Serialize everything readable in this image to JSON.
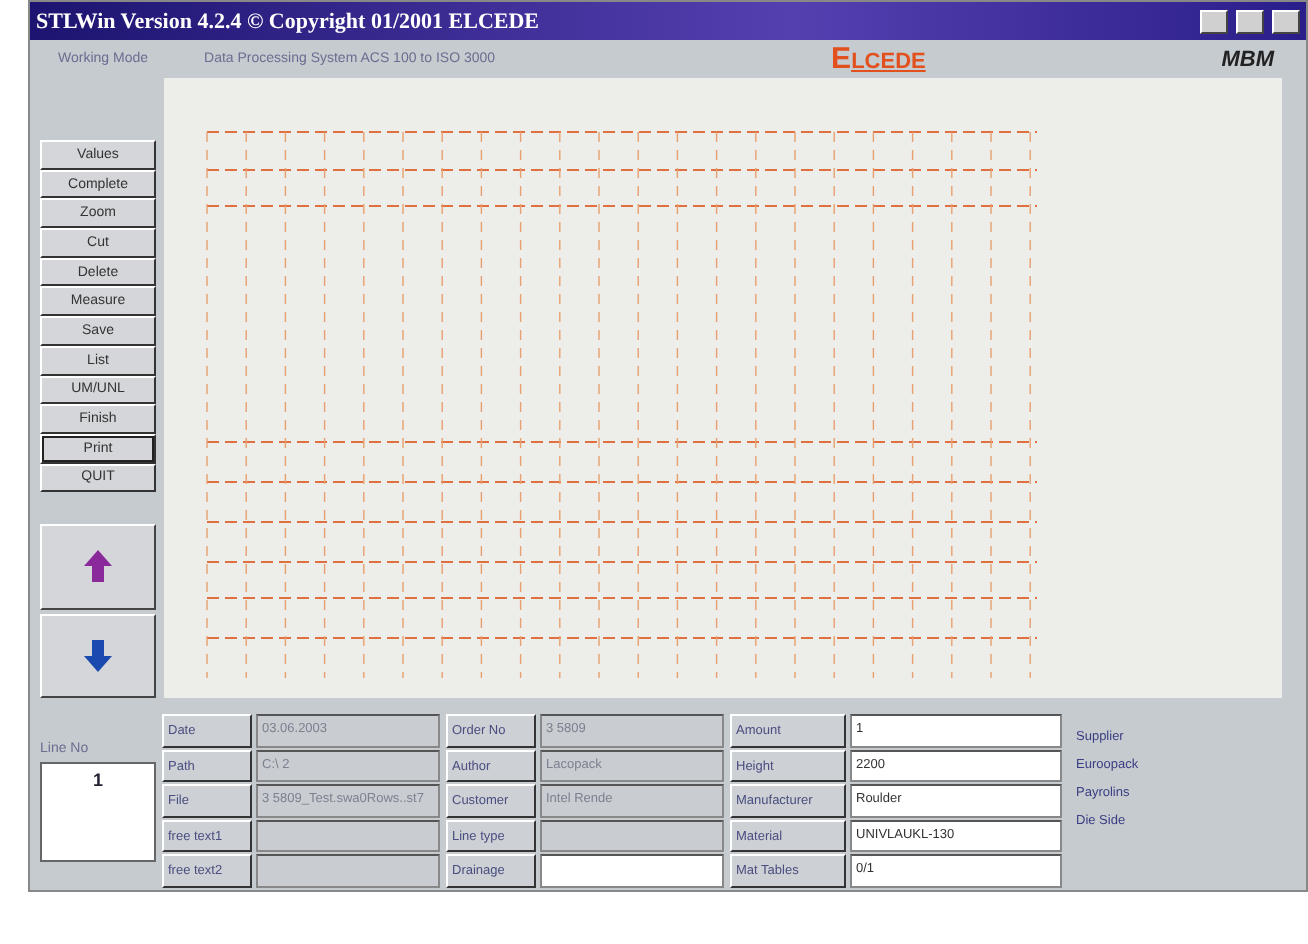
{
  "window": {
    "title": "STLWin Version 4.2.4 © Copyright 01/2001 ELCEDE"
  },
  "header": {
    "mode": "Working Mode",
    "system": "Data Processing System ACS 100 to ISO 3000",
    "logo_first": "E",
    "logo_rest": "LCEDE",
    "brand": "MBM"
  },
  "commands": [
    {
      "label": "Values",
      "selected": false
    },
    {
      "label": "Complete",
      "selected": false
    },
    {
      "label": "Zoom",
      "selected": false
    },
    {
      "label": "Cut",
      "selected": false
    },
    {
      "label": "Delete",
      "selected": false
    },
    {
      "label": "Measure",
      "selected": false
    },
    {
      "label": "Save",
      "selected": false
    },
    {
      "label": "List",
      "selected": false
    },
    {
      "label": "UM/UNL",
      "selected": false
    },
    {
      "label": "Finish",
      "selected": false
    },
    {
      "label": "Print",
      "selected": true
    },
    {
      "label": "QUIT",
      "selected": false
    }
  ],
  "line_no": {
    "label": "Line No",
    "value": "1"
  },
  "columns": [
    [
      {
        "label": "Date",
        "value": "03.06.2003",
        "disabled": true
      },
      {
        "label": "Path",
        "value": "C:\\ 2",
        "disabled": true
      },
      {
        "label": "File",
        "value": "3 5809_Test.swa0Rows..st7",
        "disabled": true
      },
      {
        "label": "free text1",
        "disabled": true
      },
      {
        "label": "free text2",
        "disabled": true
      }
    ],
    [
      {
        "label": "Order No",
        "value": "3 5809",
        "disabled": true
      },
      {
        "label": "Author",
        "value": "Lacopack",
        "disabled": true
      },
      {
        "label": "Customer",
        "value": "Intel Rende",
        "disabled": true
      },
      {
        "label": "Line type",
        "disabled": true
      },
      {
        "label": "Drainage",
        "disabled": false
      }
    ],
    [
      {
        "label": "Amount",
        "value": "1",
        "disabled": false
      },
      {
        "label": "Height",
        "value": "2200",
        "disabled": false
      },
      {
        "label": "Manufacturer",
        "value": "Roulder",
        "disabled": false
      },
      {
        "label": "Material",
        "value": "UNIVLAUKL-130",
        "disabled": false
      },
      {
        "label": "Mat Tables",
        "value": "0/1",
        "disabled": false
      }
    ]
  ],
  "notes": [
    "Supplier",
    "Euroopack",
    "Payrolins",
    "Die Side"
  ]
}
